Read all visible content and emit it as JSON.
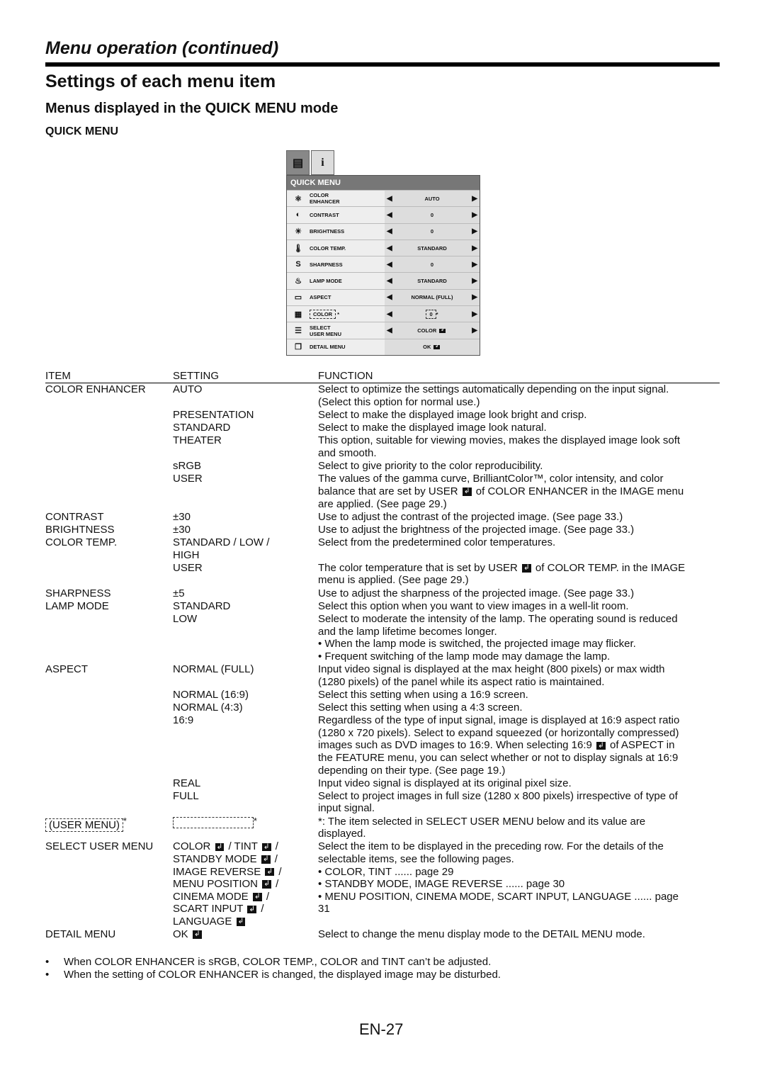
{
  "header": {
    "section": "Menu operation (continued)",
    "title": "Settings of each menu item",
    "subtitle": "Menus displayed in the QUICK MENU mode",
    "menu_heading": "QUICK MENU"
  },
  "osd": {
    "tabs": [
      {
        "icon": "picture-menu-icon",
        "label": ""
      },
      {
        "icon": "info-icon",
        "label": "i"
      }
    ],
    "title": "QUICK MENU",
    "rows": [
      {
        "icon": "color-enhancer-icon",
        "glyph": "⚛",
        "label": "COLOR\nENHANCER",
        "value": "AUTO",
        "arrows": true
      },
      {
        "icon": "contrast-icon",
        "glyph": "◐",
        "label": "CONTRAST",
        "value": "0",
        "arrows": true
      },
      {
        "icon": "brightness-icon",
        "glyph": "☀",
        "label": "BRIGHTNESS",
        "value": "0",
        "arrows": true
      },
      {
        "icon": "color-temp-icon",
        "glyph": "🌡",
        "label": "COLOR TEMP.",
        "value": "STANDARD",
        "arrows": true
      },
      {
        "icon": "sharpness-icon",
        "glyph": "S",
        "label": "SHARPNESS",
        "value": "0",
        "arrows": true
      },
      {
        "icon": "lamp-mode-icon",
        "glyph": "♨",
        "label": "LAMP MODE",
        "value": "STANDARD",
        "arrows": true
      },
      {
        "icon": "aspect-icon",
        "glyph": "▭",
        "label": "ASPECT",
        "value": "NORMAL (FULL)",
        "arrows": true
      },
      {
        "icon": "user-menu-icon",
        "glyph": "▦",
        "label": "COLOR",
        "value": "0",
        "arrows": true,
        "dashed": true
      },
      {
        "icon": "select-user-menu-icon",
        "glyph": "☰",
        "label": "SELECT\nUSER MENU",
        "value": "COLOR ↲",
        "arrows": true
      },
      {
        "icon": "detail-menu-icon",
        "glyph": "❐",
        "label": "DETAIL MENU",
        "value": "OK ↲",
        "arrows": false
      }
    ]
  },
  "table": {
    "headers": [
      "ITEM",
      "SETTING",
      "FUNCTION"
    ],
    "rows": [
      [
        "COLOR ENHANCER",
        "AUTO",
        "Select to optimize the settings automatically depending on the input signal.\n(Select this option for normal use.)"
      ],
      [
        "",
        "PRESENTATION",
        "Select to make the displayed image look bright and crisp."
      ],
      [
        "",
        "STANDARD",
        "Select to make the displayed image look natural."
      ],
      [
        "",
        "THEATER",
        "This option, suitable for viewing movies, makes the displayed image look soft\nand smooth."
      ],
      [
        "",
        "sRGB",
        "Select to give priority to the color reproducibility."
      ],
      [
        "",
        "USER",
        "The values of the gamma curve, BrilliantColor™, color intensity, and color\nbalance that are set by USER ↲ of COLOR ENHANCER in the IMAGE menu\nare applied. (See page 29.)"
      ],
      [
        "CONTRAST",
        "±30",
        "Use to adjust the contrast of the projected image. (See page 33.)"
      ],
      [
        "BRIGHTNESS",
        "±30",
        "Use to adjust the brightness of the projected image. (See page 33.)"
      ],
      [
        "COLOR TEMP.",
        "STANDARD / LOW /\nHIGH",
        "Select from the predetermined color temperatures."
      ],
      [
        "",
        "USER",
        "The color temperature that is set by USER ↲ of COLOR TEMP. in the IMAGE\nmenu is applied. (See page 29.)"
      ],
      [
        "SHARPNESS",
        "±5",
        "Use to adjust the sharpness of the projected image. (See page 33.)"
      ],
      [
        "LAMP MODE",
        "STANDARD",
        "Select this option when you want to view images in a well-lit room."
      ],
      [
        "",
        "LOW",
        "Select to moderate the intensity of the lamp. The operating sound is reduced\nand the lamp lifetime becomes longer.\n•   When the lamp mode is switched, the projected image may flicker.\n•   Frequent switching of the lamp mode may damage the lamp."
      ],
      [
        "ASPECT",
        "NORMAL (FULL)",
        "Input video signal is displayed at the max height (800 pixels) or max width\n(1280 pixels) of the panel while its aspect ratio is maintained."
      ],
      [
        "",
        "NORMAL (16:9)",
        "Select this setting when using a 16:9 screen."
      ],
      [
        "",
        "NORMAL (4:3)",
        "Select this setting when using a 4:3 screen."
      ],
      [
        "",
        "16:9",
        "Regardless of the type of input signal, image is displayed at 16:9 aspect ratio\n(1280 x 720 pixels). Select to expand squeezed (or horizontally compressed)\nimages such as DVD images to 16:9. When selecting 16:9 ↲ of ASPECT in\nthe FEATURE menu, you can select whether or not to display signals at 16:9\ndepending on their type. (See page 19.)"
      ],
      [
        "",
        "REAL",
        "Input video signal is displayed at its original pixel size."
      ],
      [
        "",
        "FULL",
        "Select to project images in full size (1280 x 800 pixels) irrespective of type of\ninput signal."
      ],
      [
        "(USER MENU)",
        "",
        "*: The item selected in SELECT USER MENU below and its value are\n   displayed."
      ],
      [
        "SELECT USER MENU",
        "COLOR ↲ / TINT ↲ /\nSTANDBY MODE ↲ /\nIMAGE REVERSE ↲ /\nMENU POSITION ↲ /\nCINEMA MODE ↲ /\nSCART INPUT ↲ /\nLANGUAGE ↲",
        "Select the item to be displayed in the preceding row. For the details of the\nselectable items, see the following pages.\n•   COLOR, TINT ...... page 29\n•   STANDBY MODE, IMAGE REVERSE ...... page 30\n•   MENU POSITION, CINEMA MODE, SCART INPUT, LANGUAGE ...... page\n    31"
      ],
      [
        "DETAIL MENU",
        "OK ↲",
        "Select to change the menu display mode to the DETAIL MENU mode."
      ]
    ]
  },
  "notes": [
    "When COLOR ENHANCER is sRGB, COLOR TEMP., COLOR and TINT can’t be adjusted.",
    "When the setting of COLOR ENHANCER is changed, the displayed image may be disturbed."
  ],
  "page_number": "EN-27"
}
